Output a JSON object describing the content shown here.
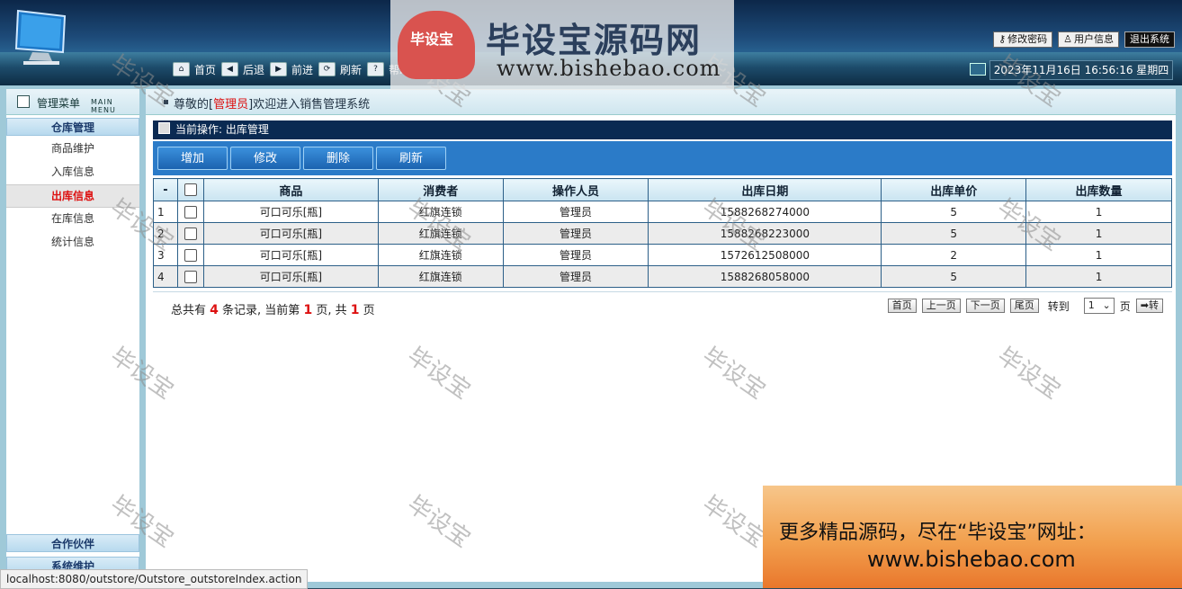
{
  "header": {
    "nav": [
      {
        "label": "首页",
        "icon": "home-icon"
      },
      {
        "label": "后退",
        "icon": "arrow-left-icon"
      },
      {
        "label": "前进",
        "icon": "arrow-right-icon"
      },
      {
        "label": "刷新",
        "icon": "refresh-icon"
      },
      {
        "label": "帮助",
        "icon": "help-icon"
      }
    ],
    "change_password": "修改密码",
    "user_info": "用户信息",
    "logout": "退出系统",
    "datetime": "2023年11月16日 16:56:16 星期四"
  },
  "sidebar": {
    "title": "管理菜单",
    "title_en": "MAIN MENU",
    "group_warehouse": "仓库管理",
    "items": [
      "商品维护",
      "入库信息",
      "出库信息",
      "在库信息",
      "统计信息"
    ],
    "active_item": "出库信息",
    "group_partner": "合作伙伴",
    "group_system": "系统维护"
  },
  "welcome": {
    "prefix": "尊敬的[",
    "role": "管理员",
    "suffix": "]欢迎进入销售管理系统"
  },
  "crumb": "当前操作: 出库管理",
  "toolbar": {
    "add": "增加",
    "edit": "修改",
    "delete": "删除",
    "refresh": "刷新"
  },
  "table": {
    "headers": [
      "-",
      "",
      "商品",
      "消费者",
      "操作人员",
      "出库日期",
      "出库单价",
      "出库数量"
    ],
    "rows": [
      [
        "1",
        "可口可乐[瓶]",
        "红旗连锁",
        "管理员",
        "1588268274000",
        "5",
        "1"
      ],
      [
        "2",
        "可口可乐[瓶]",
        "红旗连锁",
        "管理员",
        "1588268223000",
        "5",
        "1"
      ],
      [
        "3",
        "可口可乐[瓶]",
        "红旗连锁",
        "管理员",
        "1572612508000",
        "2",
        "1"
      ],
      [
        "4",
        "可口可乐[瓶]",
        "红旗连锁",
        "管理员",
        "1588268058000",
        "5",
        "1"
      ]
    ]
  },
  "pager": {
    "t1": "总共有",
    "total": "4",
    "t2": "条记录, 当前第",
    "current": "1",
    "t3": "页, 共",
    "pages": "1",
    "t4": "页",
    "first": "首页",
    "prev": "上一页",
    "next": "下一页",
    "last": "尾页",
    "goto": "转到",
    "page_value": "1",
    "page_unit": "页",
    "go": "➡转"
  },
  "watermark": {
    "text": "毕设宝",
    "logo_seal": "毕设宝",
    "logo_title": "毕设宝源码网",
    "logo_url": "www.bishebao.com",
    "promo_line1": "更多精品源码，尽在“毕设宝”网址：",
    "promo_line2": "www.bishebao.com"
  },
  "status_url": "localhost:8080/outstore/Outstore_outstoreIndex.action"
}
